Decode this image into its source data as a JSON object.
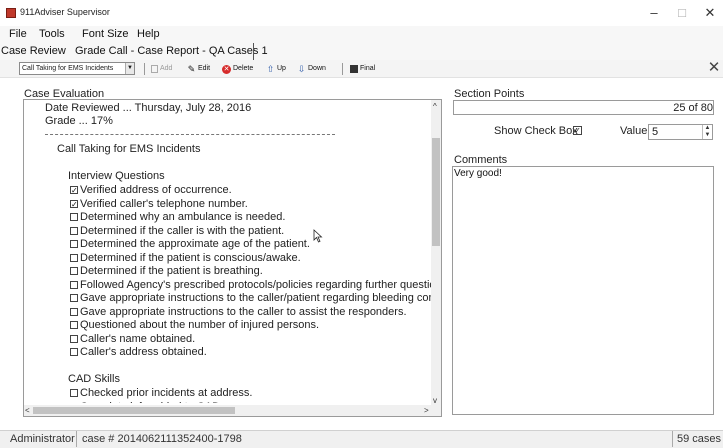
{
  "window": {
    "title": "911Adviser Supervisor",
    "controls": [
      "–",
      "□",
      "✕"
    ]
  },
  "menu": [
    "File",
    "Tools",
    "Font Size",
    "Help"
  ],
  "tabs": {
    "case_review": "Case Review",
    "active": "Grade Call - Case Report - QA Cases 1"
  },
  "toolbar": {
    "select_value": "Call Taking for EMS Incidents",
    "add": "Add",
    "edit": "Edit",
    "delete": "Delete",
    "up": "Up",
    "down": "Down",
    "final": "Final",
    "close": "✕"
  },
  "evaluation": {
    "label": "Case Evaluation",
    "date_reviewed": "Date Reviewed ... Thursday, July 28, 2016",
    "grade": "Grade ... 17%",
    "section_title": "Call Taking for EMS Incidents",
    "interview_heading": "Interview Questions",
    "interview_items": [
      {
        "text": "Verified address of occurrence.",
        "checked": true
      },
      {
        "text": "Verified caller's telephone number.",
        "checked": true
      },
      {
        "text": "Determined why an ambulance is needed.",
        "checked": false
      },
      {
        "text": "Determined if the caller is with the patient.",
        "checked": false
      },
      {
        "text": "Determined the approximate age of the patient.",
        "checked": false
      },
      {
        "text": "Determined if the patient is conscious/awake.",
        "checked": false
      },
      {
        "text": "Determined if the patient is breathing.",
        "checked": false
      },
      {
        "text": "Followed Agency's prescribed protocols/policies regarding further questioning for",
        "checked": false
      },
      {
        "text": "Gave appropriate instructions to the caller/patient regarding bleeding control, airw",
        "checked": false
      },
      {
        "text": "Gave appropriate instructions to the caller to assist the responders.",
        "checked": false
      },
      {
        "text": "Questioned about the number of injured persons.",
        "checked": false
      },
      {
        "text": "Caller's name obtained.",
        "checked": false
      },
      {
        "text": "Caller's address obtained.",
        "checked": false
      }
    ],
    "cad_heading": "CAD Skills",
    "cad_items": [
      {
        "text": "Checked prior incidents at address.",
        "checked": false
      },
      {
        "text": "Complete info added to CAD.",
        "checked": false
      }
    ]
  },
  "section_points": {
    "label": "Section Points",
    "value": "25 of 80"
  },
  "show_check_box": {
    "label": "Show Check Box",
    "checked": true
  },
  "value_field": {
    "label": "Value",
    "value": "5"
  },
  "comments": {
    "label": "Comments",
    "text": "Very good!"
  },
  "status": {
    "user": "Administrator",
    "case": "case # 2014062111352400-1798",
    "count": "59 cases"
  },
  "colors": {
    "app_icon": "#c0392b",
    "delete_icon": "#d62b2b",
    "up_down_icon": "#2e5aa8"
  }
}
